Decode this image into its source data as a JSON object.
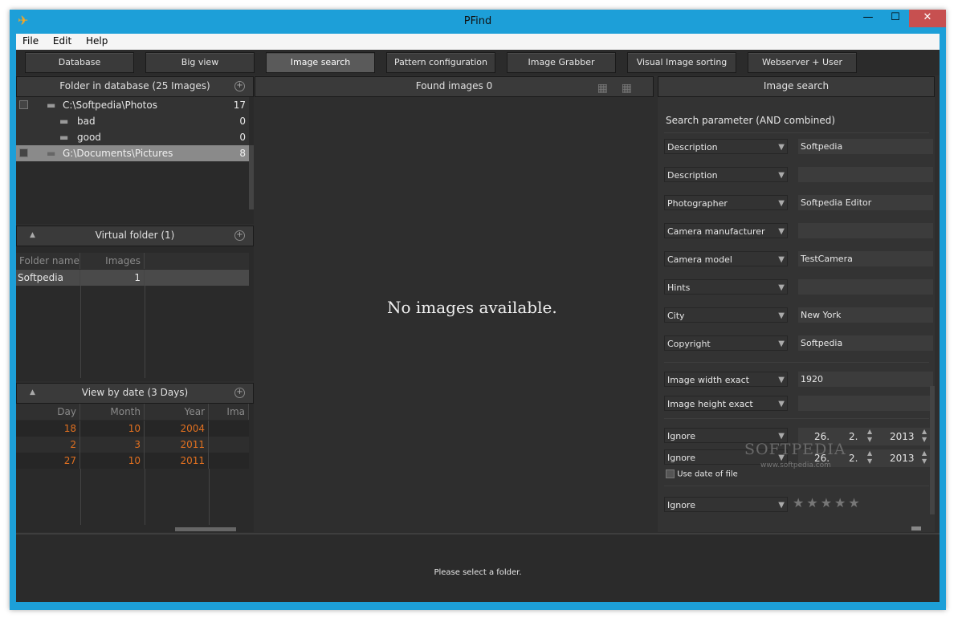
{
  "window": {
    "title": "PFind",
    "minimize": "—",
    "maximize": "☐",
    "close": "✕"
  },
  "menu": [
    "File",
    "Edit",
    "Help"
  ],
  "toolbar": [
    "Database",
    "Big view",
    "Image search",
    "Pattern configuration",
    "Image Grabber",
    "Visual Image sorting",
    "Webserver + User"
  ],
  "active_tab": "Image search",
  "folders_panel": {
    "title": "Folder in database (25 Images)",
    "rows": [
      {
        "name": "C:\\Softpedia\\Photos",
        "count": "17",
        "checked": true
      },
      {
        "name": "bad",
        "count": "0",
        "checked": false
      },
      {
        "name": "good",
        "count": "0",
        "checked": false
      },
      {
        "name": "G:\\Documents\\Pictures",
        "count": "8",
        "checked": true
      }
    ]
  },
  "virtual_panel": {
    "title": "Virtual folder (1)",
    "headers": [
      "Folder name",
      "Images"
    ],
    "rows": [
      {
        "name": "Softpedia",
        "images": "1"
      }
    ]
  },
  "date_panel": {
    "title": "View by date (3 Days)",
    "headers": [
      "Day",
      "Month",
      "Year",
      "Ima"
    ],
    "rows": [
      {
        "day": "18",
        "month": "10",
        "year": "2004"
      },
      {
        "day": "2",
        "month": "3",
        "year": "2011"
      },
      {
        "day": "27",
        "month": "10",
        "year": "2011"
      }
    ]
  },
  "center": {
    "header": "Found images 0",
    "message": "No images available."
  },
  "search": {
    "title": "Image search",
    "params_title": "Search parameter (AND combined)",
    "fields": [
      {
        "label": "Description",
        "value": "Softpedia"
      },
      {
        "label": "Description",
        "value": ""
      },
      {
        "label": "Photographer",
        "value": "Softpedia Editor"
      },
      {
        "label": "Camera manufacturer",
        "value": ""
      },
      {
        "label": "Camera model",
        "value": "TestCamera"
      },
      {
        "label": "Hints",
        "value": ""
      },
      {
        "label": "City",
        "value": "New York"
      },
      {
        "label": "Copyright",
        "value": "Softpedia"
      }
    ],
    "size_fields": [
      {
        "label": "Image width exact",
        "value": "1920"
      },
      {
        "label": "Image height exact",
        "value": ""
      }
    ],
    "dates": [
      {
        "mode": "Ignore",
        "day": "26.",
        "month": "2.",
        "year": "2013"
      },
      {
        "mode": "Ignore",
        "day": "26.",
        "month": "2.",
        "year": "2013"
      }
    ],
    "use_date_label": "Use date of file",
    "rating_mode": "Ignore",
    "stars": 5
  },
  "watermark": {
    "logo": "SOFTPEDIA",
    "url": "www.softpedia.com"
  },
  "status": "Please select a folder.",
  "colors": {
    "window_border": "#1d9fd8",
    "panel_bg": "#2e2e2e",
    "accent_orange": "#e07020"
  }
}
